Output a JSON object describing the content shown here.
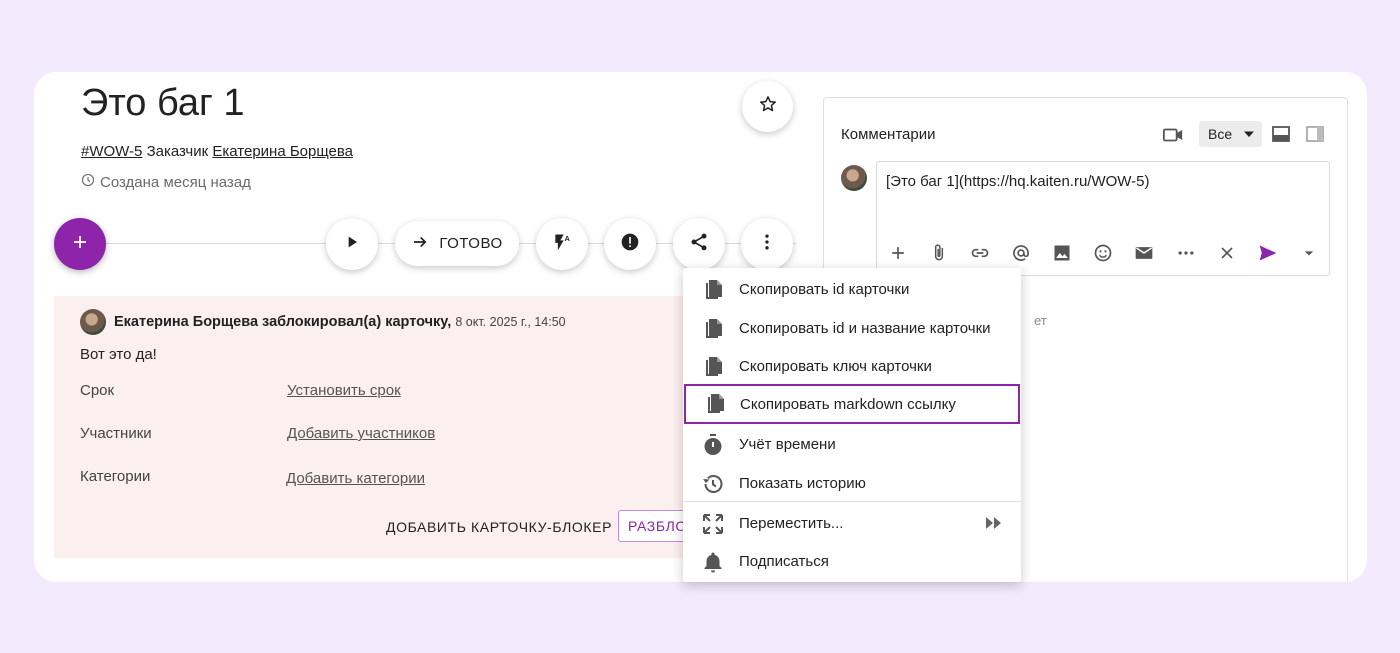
{
  "card": {
    "title": "Это баг 1",
    "id_link": "#WOW-5",
    "customer_label": "Заказчик",
    "customer_name": "Екатерина Борщева",
    "created": "Создана месяц назад"
  },
  "actions": {
    "done_label": "ГОТОВО"
  },
  "block": {
    "author": "Екатерина Борщева",
    "action": "заблокировал(а) карточку,",
    "date": "8 окт. 2025 г., 14:50",
    "text": "Вот это да!",
    "rows": [
      {
        "label": "Срок",
        "value": "Установить срок"
      },
      {
        "label": "Участники",
        "value": "Добавить участников"
      },
      {
        "label": "Категории",
        "value": "Добавить категории"
      }
    ],
    "add_blocker": "ДОБАВИТЬ КАРТОЧКУ-БЛОКЕР",
    "unblock": "РАЗБЛО"
  },
  "comments": {
    "title": "Комментарии",
    "filter": "Все",
    "draft": "[Это баг 1](https://hq.kaiten.ru/WOW-5)",
    "hint": "ет"
  },
  "menu": {
    "items": [
      {
        "label": "Скопировать id карточки",
        "icon": "copy-icon"
      },
      {
        "label": "Скопировать id и название карточки",
        "icon": "copy-icon"
      },
      {
        "label": "Скопировать ключ карточки",
        "icon": "copy-icon"
      },
      {
        "label": "Скопировать markdown ссылку",
        "icon": "copy-icon",
        "selected": true
      },
      {
        "label": "Учёт времени",
        "icon": "timer-icon"
      },
      {
        "label": "Показать историю",
        "icon": "history-icon"
      },
      {
        "label": "Переместить...",
        "icon": "move-icon"
      },
      {
        "label": "Подписаться",
        "icon": "bell-icon"
      }
    ]
  },
  "colors": {
    "accent": "#8e24aa",
    "background": "#f3eafd",
    "blocked_panel": "#fcefef"
  }
}
